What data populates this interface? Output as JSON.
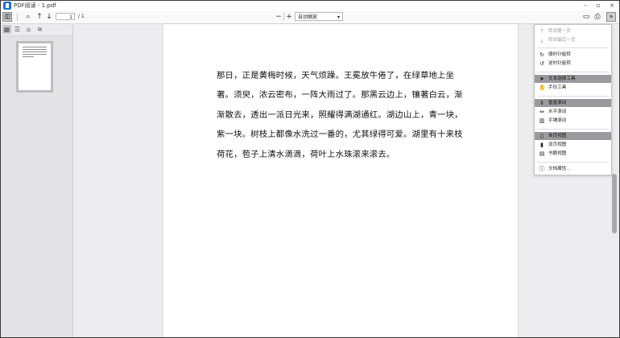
{
  "window": {
    "title": "PDF阅读 - 1.pdf",
    "min_label": "–",
    "max_label": "▫",
    "close_label": "×"
  },
  "toolbar": {
    "sidebar_toggle_icon": "▥",
    "search_icon": "⌕",
    "prev_icon": "↑",
    "next_icon": "↓",
    "page_number": "1",
    "page_total": "/ 1",
    "zoom_out_icon": "−",
    "zoom_in_icon": "+",
    "zoom_value": "自动缩放",
    "zoom_caret": "▾",
    "open_icon": "▭",
    "print_icon": "⎙",
    "more_icon": "»"
  },
  "sidebar": {
    "thumb_view_icon": "▦",
    "outline_icon": "☰",
    "attachments_icon": "⌂",
    "layers_icon": "≋"
  },
  "document": {
    "text": "那日，正是黄梅时候，天气烦躁。王冕放牛倦了，在绿草地上坐著。须臾，浓云密布，一阵大雨过了。那黑云边上，镶著白云，渐渐散去，透出一派日光来，照耀得满湖通红。湖边山上，青一块，紫一块。树枝上都像水洗过一番的，尤其绿得可爱。湖里有十来枝荷花，苞子上清水滴滴，荷叶上水珠滚来滚去。"
  },
  "menu": {
    "items": [
      {
        "icon": "⤒",
        "label": "转到第一页",
        "state": "disabled"
      },
      {
        "icon": "⤓",
        "label": "转到最后一页",
        "state": "disabled"
      },
      {
        "icon": "↻",
        "label": "顺时针旋转",
        "state": "normal"
      },
      {
        "icon": "↺",
        "label": "逆时针旋转",
        "state": "normal"
      },
      {
        "icon": "➤",
        "label": "文本选择工具",
        "state": "selected"
      },
      {
        "icon": "✋",
        "label": "手形工具",
        "state": "normal"
      },
      {
        "icon": "⇕",
        "label": "垂直滚动",
        "state": "selected"
      },
      {
        "icon": "⇔",
        "label": "水平滚动",
        "state": "normal"
      },
      {
        "icon": "▥",
        "label": "平铺滚动",
        "state": "normal"
      },
      {
        "icon": "▯",
        "label": "单页视图",
        "state": "selected"
      },
      {
        "icon": "▮",
        "label": "双页视图",
        "state": "normal"
      },
      {
        "icon": "▤",
        "label": "书籍视图",
        "state": "normal"
      },
      {
        "icon": "ⓘ",
        "label": "文档属性…",
        "state": "normal"
      }
    ]
  },
  "colors": {
    "accent": "#1f6fd1",
    "selected_row": "#9a9a9e",
    "viewer_bg": "#ededf0"
  }
}
